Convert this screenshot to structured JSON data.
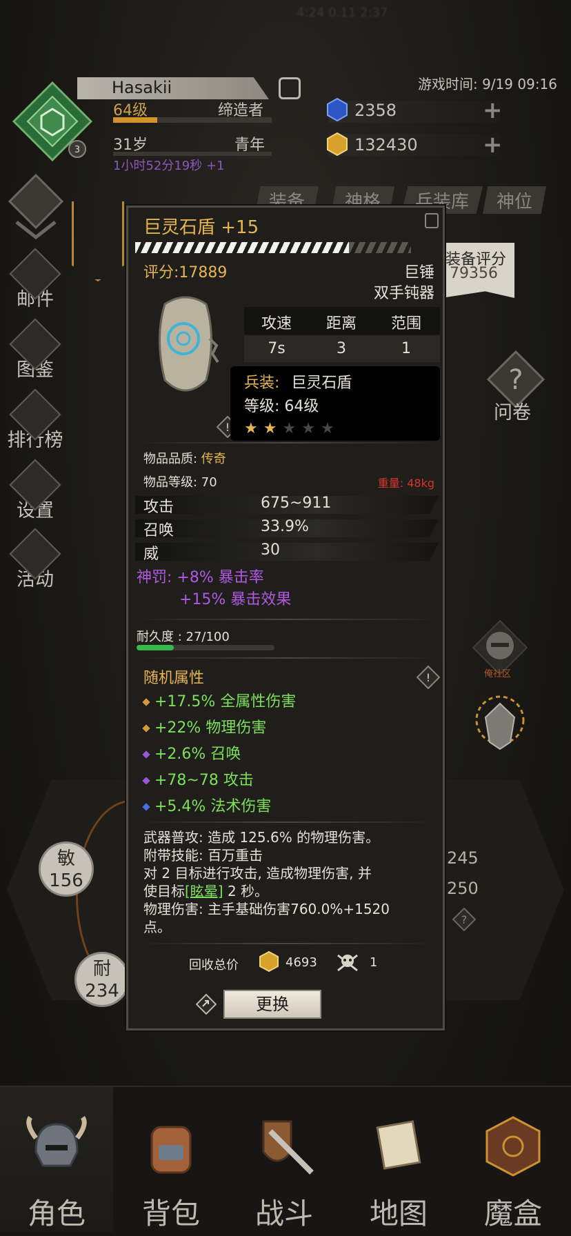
{
  "status": {
    "blur_text": "4:24 0.11 2:37"
  },
  "player": {
    "name": "Hasakii",
    "level_badge": "3",
    "level": "64级",
    "class": "缔造者",
    "level_progress": 0.28,
    "age": "31岁",
    "stage": "青年",
    "timer": "1小时52分19秒 +1"
  },
  "game_time": "游戏时间: 9/19 09:16",
  "currency": {
    "gems": "2358",
    "gold": "132430"
  },
  "tabs": [
    "装备",
    "神格",
    "兵装库",
    "神位"
  ],
  "side_menu": [
    {
      "label": "邮件",
      "icon": "mail-icon"
    },
    {
      "label": "图鉴",
      "icon": "book-icon"
    },
    {
      "label": "排行榜",
      "icon": "ranking-icon"
    },
    {
      "label": "设置",
      "icon": "gear-icon"
    },
    {
      "label": "活动",
      "icon": "event-icon"
    }
  ],
  "right": {
    "equip_score_label": "装备评分",
    "equip_score": "79356",
    "quiz": "问卷",
    "community": "俺社区",
    "stat_right_1": "245",
    "stat_right_2": "250"
  },
  "stats_hex": {
    "agi_label": "敏",
    "agi_value": "156",
    "end_label": "耐",
    "end_value": "234"
  },
  "item": {
    "title": "巨灵石盾 +15",
    "score": "评分:17889",
    "weapon_type": "巨锤",
    "weapon_class": "双手钝器",
    "table_headers": [
      "攻速",
      "距离",
      "范围"
    ],
    "table_values": [
      "7s",
      "3",
      "1"
    ],
    "arms_key": "兵装:",
    "arms_value": "巨灵石盾",
    "level_key": "等级:",
    "level_value": "64级",
    "stars_filled": 2,
    "stars_total": 5,
    "quality_label": "物品品质: ",
    "quality_value": "传奇",
    "item_level": "物品等级: 70",
    "weight": "重量:  48kg",
    "stats": [
      {
        "name": "攻击",
        "value": "675~911"
      },
      {
        "name": "召唤",
        "value": "33.9%"
      },
      {
        "name": "威",
        "value": "30"
      }
    ],
    "divine_1": "神罚: +8% 暴击率",
    "divine_2": "+15% 暴击效果",
    "durability": "耐久度 : 27/100",
    "durability_ratio": 0.27,
    "random_header": "随机属性",
    "random": [
      {
        "text": "+17.5% 全属性伤害",
        "color": "#d79a3a"
      },
      {
        "text": "+22% 物理伤害",
        "color": "#d79a3a"
      },
      {
        "text": "+2.6% 召唤",
        "color": "#9a55d8"
      },
      {
        "text": "+78~78 攻击",
        "color": "#9a55d8"
      },
      {
        "text": "+5.4% 法术伤害",
        "color": "#4a6ee0"
      }
    ],
    "desc_1": "武器普攻: 造成 125.6% 的物理伤害。",
    "desc_2": "附带技能: 百万重击",
    "desc_3": "对 2 目标进行攻击, 造成物理伤害, 并",
    "desc_4a": "使目标",
    "desc_4b": "[眩晕]",
    "desc_4c": " 2 秒。",
    "desc_5": "物理伤害: 主手基础伤害760.0%+1520",
    "desc_6": "点。",
    "recycle_label": "回收总价",
    "recycle_gold": "4693",
    "recycle_skull": "1",
    "replace_button": "更换"
  },
  "bottom_nav": [
    "角色",
    "背包",
    "战斗",
    "地图",
    "魔盒"
  ],
  "colors": {
    "accent": "#e7b552",
    "green": "#7ee05a",
    "purple": "#b159e3",
    "red": "#d8342c"
  }
}
